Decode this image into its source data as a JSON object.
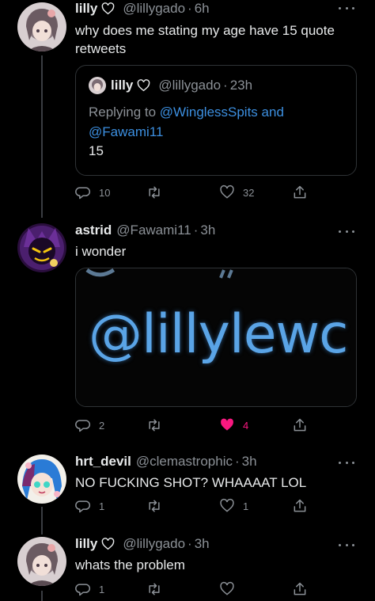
{
  "colors": {
    "background": "#000000",
    "text": "#e7e9ea",
    "muted": "#8b9096",
    "link": "#3c8fe0",
    "like": "#f91880",
    "border": "#2f3336"
  },
  "tweets": [
    {
      "name": "lilly",
      "name_badge": "heart-outline-icon",
      "handle": "@lillygado",
      "separator": "·",
      "time": "6h",
      "text": "why does me stating my age have 15 quote retweets",
      "quote": {
        "name": "lilly",
        "handle": "@lillygado",
        "separator": "·",
        "time": "23h",
        "replying_prefix": "Replying to",
        "mention_1": "@WinglessSpits",
        "joiner": "and",
        "mention_2": "@Fawami11",
        "body": "15"
      },
      "actions": {
        "replies": "10",
        "retweets": "",
        "likes": "32"
      }
    },
    {
      "name": "astrid",
      "handle": "@Fawami11",
      "separator": "·",
      "time": "3h",
      "text": "i wonder",
      "media_text": "@lillylewc",
      "actions": {
        "replies": "2",
        "retweets": "",
        "likes": "4",
        "liked": true
      }
    },
    {
      "name": "hrt_devil",
      "handle": "@clemastrophic",
      "separator": "·",
      "time": "3h",
      "text": "NO FUCKING SHOT? WHAAAAT LOL",
      "actions": {
        "replies": "1",
        "retweets": "",
        "likes": "1"
      }
    },
    {
      "name": "lilly",
      "name_badge": "heart-outline-icon",
      "handle": "@lillygado",
      "separator": "·",
      "time": "3h",
      "text": "whats the problem",
      "actions": {
        "replies": "1",
        "retweets": "",
        "likes": ""
      }
    }
  ]
}
